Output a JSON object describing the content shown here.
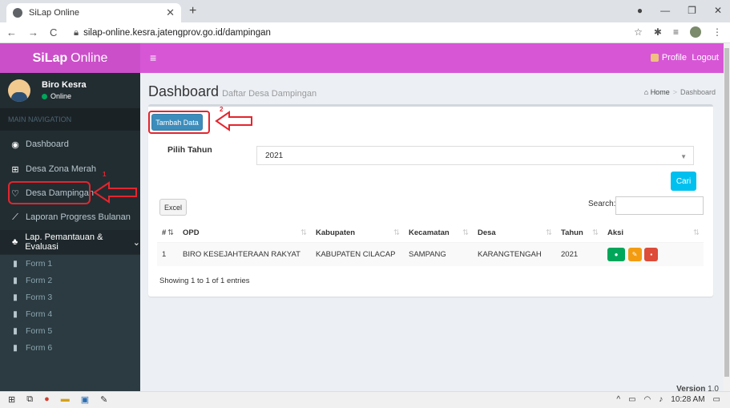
{
  "browser": {
    "tab_title": "SiLap Online",
    "url": "silap-online.kesra.jatengprov.go.id/dampingan"
  },
  "app": {
    "brand_bold": "SiLap",
    "brand_rest": "Online",
    "profile_label": "Profile",
    "logout_label": "Logout"
  },
  "user": {
    "name": "Biro Kesra",
    "status": "Online"
  },
  "sidebar": {
    "header": "MAIN NAVIGATION",
    "items": [
      {
        "label": "Dashboard",
        "icon": "dashboard-icon"
      },
      {
        "label": "Desa Zona Merah",
        "icon": "plus-square-icon"
      },
      {
        "label": "Desa Dampingan",
        "icon": "heart-icon"
      },
      {
        "label": "Laporan Progress Bulanan",
        "icon": "line-chart-icon"
      },
      {
        "label": "Lap. Pemantauan & Evaluasi",
        "icon": "sitemap-icon"
      }
    ],
    "subitems": [
      "Form 1",
      "Form 2",
      "Form 3",
      "Form 4",
      "Form 5",
      "Form 6"
    ]
  },
  "page": {
    "title": "Dashboard",
    "subtitle": "Daftar Desa Dampingan",
    "breadcrumb_home": "Home",
    "breadcrumb_current": "Dashboard"
  },
  "form": {
    "add_button": "Tambah Data",
    "year_label": "Pilih Tahun",
    "year_value": "2021",
    "search_button": "Cari",
    "excel_button": "Excel",
    "search_label": "Search:"
  },
  "table": {
    "headers": [
      "#",
      "OPD",
      "Kabupaten",
      "Kecamatan",
      "Desa",
      "Tahun",
      "Aksi"
    ],
    "rows": [
      [
        "1",
        "BIRO KESEJAHTERAAN RAKYAT",
        "KABUPATEN CILACAP",
        "SAMPANG",
        "KARANGTENGAH",
        "2021"
      ]
    ],
    "info": "Showing 1 to 1 of 1 entries"
  },
  "footer": {
    "version_label": "Version",
    "version_value": "1.0"
  },
  "annotations": {
    "one": "1",
    "two": "2"
  },
  "taskbar": {
    "time": "10:28 AM"
  },
  "colors": {
    "brand": "#cb4fc9",
    "topnav": "#d756d6",
    "sidebar": "#222d32",
    "primary": "#3c8dbc",
    "info": "#00c0ef",
    "annotation": "#e3262e"
  }
}
